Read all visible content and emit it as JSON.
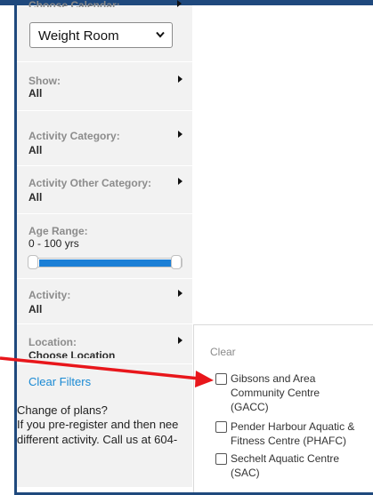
{
  "sidebar": {
    "cut_label": "Choose Calendar:",
    "calendar_select": {
      "value": "Weight Room"
    },
    "filters": [
      {
        "label": "Show:",
        "value": "All"
      },
      {
        "label": "Activity Category:",
        "value": "All"
      },
      {
        "label": "Activity Other Category:",
        "value": "All"
      }
    ],
    "age_range": {
      "label": "Age Range:",
      "value": "0 - 100 yrs",
      "min": 0,
      "max": 100
    },
    "activity": {
      "label": "Activity:",
      "value": "All"
    },
    "location": {
      "label": "Location:",
      "value": "Choose Location"
    },
    "clear_filters": "Clear Filters"
  },
  "notice": {
    "line1": "Change of plans?",
    "line2": "If you pre-register and then nee",
    "line3": "different activity. Call us at 604-"
  },
  "location_panel": {
    "clear_label": "Clear",
    "options": [
      {
        "line1": "Gibsons and Area",
        "line2": "Community Centre",
        "line3": "(GACC)"
      },
      {
        "line1": "Pender Harbour Aquatic &",
        "line2": "Fitness Centre (PHAFC)"
      },
      {
        "line1": "Sechelt Aquatic Centre",
        "line2": "(SAC)"
      }
    ]
  },
  "annotation": {
    "arrow_color": "#e8161b"
  }
}
